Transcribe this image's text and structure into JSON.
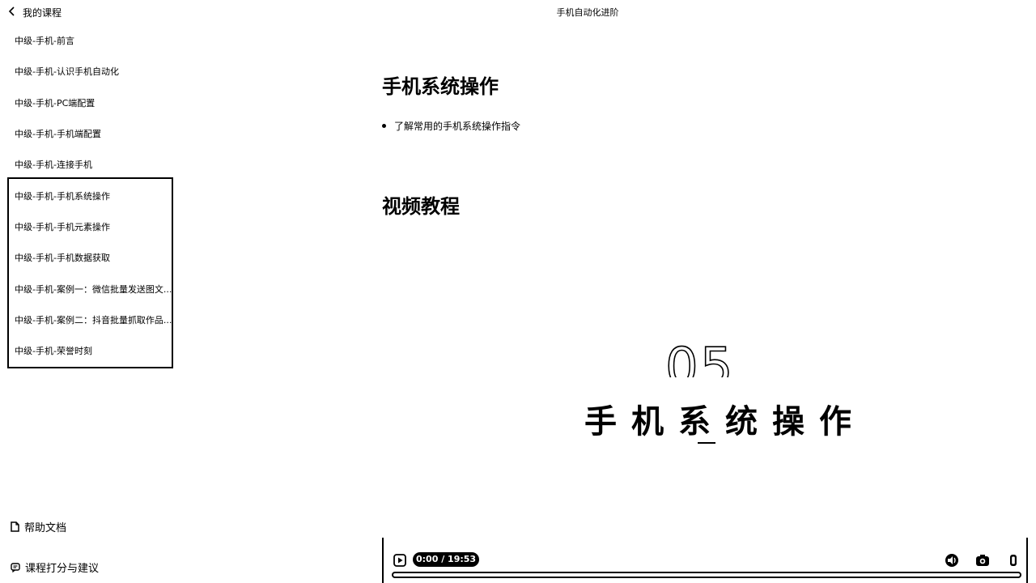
{
  "sidebar": {
    "back_label": "我的课程",
    "lessons": [
      {
        "label": "中级-手机-前言"
      },
      {
        "label": "中级-手机-认识手机自动化"
      },
      {
        "label": "中级-手机-PC端配置"
      },
      {
        "label": "中级-手机-手机端配置"
      },
      {
        "label": "中级-手机-连接手机"
      },
      {
        "label": "中级-手机-手机系统操作"
      },
      {
        "label": "中级-手机-手机元素操作"
      },
      {
        "label": "中级-手机-手机数据获取"
      },
      {
        "label": "中级-手机-案例一：微信批量发送图文..."
      },
      {
        "label": "中级-手机-案例二：抖音批量抓取作品..."
      },
      {
        "label": "中级-手机-荣誉时刻"
      }
    ],
    "help_label": "帮助文档",
    "rate_label": "课程打分与建议"
  },
  "header": {
    "title": "手机自动化进阶"
  },
  "main": {
    "heading": "手机系统操作",
    "bullet": "了解常用的手机系统操作指令",
    "video_heading": "视频教程"
  },
  "video": {
    "number": "05",
    "title": "手机系统操作",
    "time": "0:00 / 19:53",
    "progress": 0
  }
}
